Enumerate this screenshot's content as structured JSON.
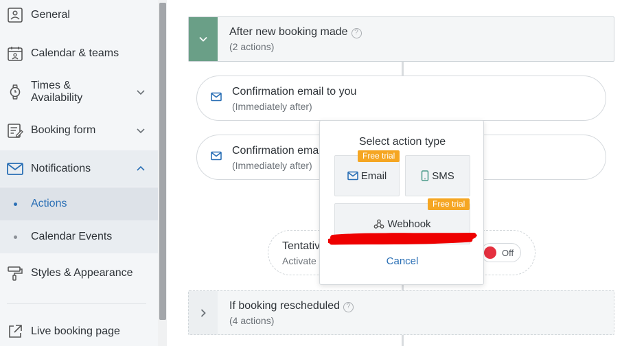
{
  "sidebar": {
    "items": [
      {
        "label": "General",
        "icon": "general-icon"
      },
      {
        "label": "Calendar & teams",
        "icon": "calendar-icon"
      },
      {
        "label": "Times & Availability",
        "line1": "Times &",
        "line2": "Availability",
        "icon": "watch-icon"
      },
      {
        "label": "Booking form",
        "icon": "form-icon"
      },
      {
        "label": "Notifications",
        "icon": "envelope-icon",
        "expanded": true
      },
      {
        "label": "Actions",
        "active": true
      },
      {
        "label": "Calendar Events"
      },
      {
        "label": "Styles & Appearance",
        "icon": "paint-roller-icon"
      },
      {
        "label": "Live booking page",
        "icon": "external-link-icon"
      }
    ]
  },
  "triggers": [
    {
      "title": "After new booking made",
      "count": "(2 actions)",
      "expanded": true
    },
    {
      "title": "If booking rescheduled",
      "count": "(4 actions)",
      "expanded": false
    }
  ],
  "actions": [
    {
      "title": "Confirmation email to you",
      "timing": "(Immediately after)"
    },
    {
      "title": "Confirmation email",
      "visible_title": "Confirmation ema",
      "timing": "(Immediately after)"
    }
  ],
  "tentative": {
    "title": "Tentativ",
    "sub": "Activate",
    "toggle_label": "Off"
  },
  "popup": {
    "title": "Select action type",
    "options": [
      {
        "label": "Email",
        "icon": "envelope-icon",
        "badge": "Free trial"
      },
      {
        "label": "SMS",
        "icon": "phone-icon"
      },
      {
        "label": "Webhook",
        "icon": "webhook-icon",
        "badge": "Free trial"
      }
    ],
    "cancel": "Cancel"
  },
  "colors": {
    "accent_green": "#6a9f87",
    "link_blue": "#2a6fb5",
    "badge_orange": "#f5a623",
    "toggle_red": "#e5303f",
    "redaction_red": "#ee0000"
  }
}
